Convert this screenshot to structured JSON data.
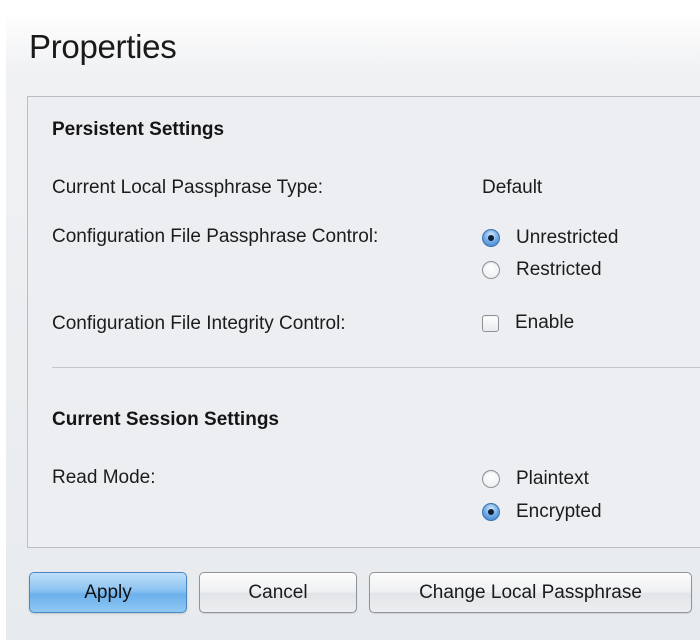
{
  "page": {
    "title": "Properties"
  },
  "persistent": {
    "heading": "Persistent Settings",
    "passphrase_type_label": "Current Local Passphrase Type:",
    "passphrase_type_value": "Default",
    "passphrase_control_label": "Configuration File Passphrase Control:",
    "passphrase_control_options": [
      {
        "label": "Unrestricted",
        "checked": true
      },
      {
        "label": "Restricted",
        "checked": false
      }
    ],
    "integrity_label": "Configuration File Integrity Control:",
    "integrity_option_label": "Enable",
    "integrity_checked": false
  },
  "session": {
    "heading": "Current Session Settings",
    "read_mode_label": "Read Mode:",
    "read_mode_options": [
      {
        "label": "Plaintext",
        "checked": false
      },
      {
        "label": "Encrypted",
        "checked": true
      }
    ]
  },
  "buttons": {
    "apply": "Apply",
    "cancel": "Cancel",
    "change_passphrase": "Change Local Passphrase"
  },
  "colors": {
    "primary_button": "#8cc3f1",
    "radio_checked": "#6ba7e4",
    "panel_background": "#eceef1"
  }
}
